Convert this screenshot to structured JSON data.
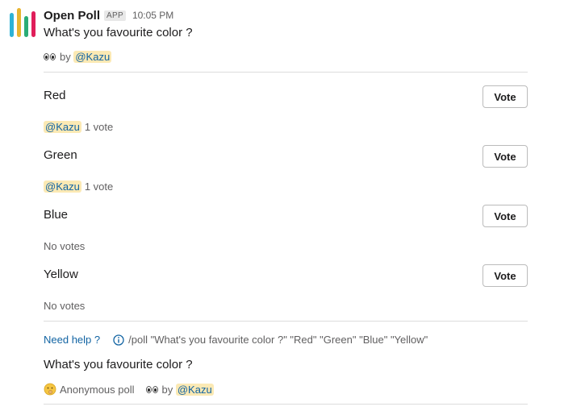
{
  "app": {
    "name": "Open Poll",
    "badge": "APP",
    "timestamp": "10:05 PM",
    "icon": "bar-chart-logo-icon",
    "logo_colors": [
      "#2eb2d6",
      "#e8b530",
      "#2bac76",
      "#e01e5a"
    ]
  },
  "poll": {
    "question": "What's you favourite color ?",
    "by_prefix": "by",
    "author_mention": "@Kazu",
    "vote_label": "Vote",
    "options": [
      {
        "label": "Red",
        "voter": "@Kazu",
        "votes_text": "1 vote"
      },
      {
        "label": "Green",
        "voter": "@Kazu",
        "votes_text": "1 vote"
      },
      {
        "label": "Blue",
        "votes_text": "No votes"
      },
      {
        "label": "Yellow",
        "votes_text": "No votes"
      }
    ]
  },
  "help": {
    "link": "Need help ?",
    "icon": "info-icon",
    "command": "/poll \"What's you favourite color ?\" \"Red\" \"Green\" \"Blue\" \"Yellow\""
  },
  "summary": {
    "question": "What's you favourite color ?",
    "anonymous_label": "Anonymous poll",
    "by_prefix": "by",
    "author_mention": "@Kazu"
  },
  "colors": {
    "mention_bg": "#fbe9b4",
    "mention_text": "#1264a3",
    "link": "#1264a3"
  }
}
